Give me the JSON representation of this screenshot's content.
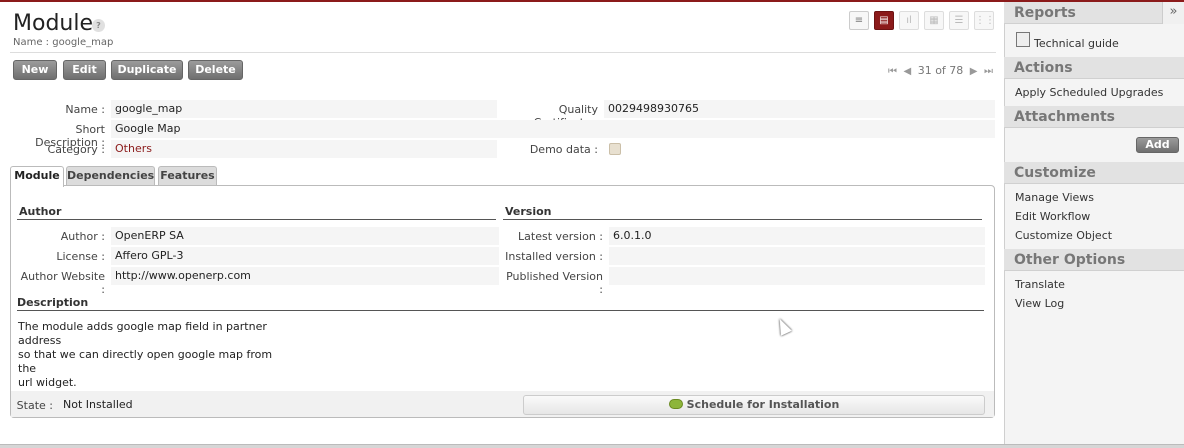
{
  "page": {
    "title": "Module",
    "help": "?",
    "subtitle": "Name : google_map"
  },
  "view_switcher": {
    "icons": [
      "list-view-icon",
      "form-view-icon",
      "graph-view-icon",
      "calendar-view-icon",
      "gantt-view-icon",
      "diagram-view-icon"
    ],
    "active": "form-view-icon"
  },
  "toolbar": {
    "new": "New",
    "edit": "Edit",
    "duplicate": "Duplicate",
    "delete": "Delete"
  },
  "pager": {
    "first": "⏮",
    "prev": "◀",
    "text": "31 of 78",
    "next": "▶",
    "last": "⏭"
  },
  "form": {
    "name_label": "Name :",
    "name_value": "google_map",
    "quality_label": "Quality Certificate :",
    "quality_value": "0029498930765",
    "short_desc_label": "Short Description :",
    "short_desc_value": "Google Map",
    "category_label": "Category :",
    "category_value": "Others",
    "demo_label": "Demo data :",
    "demo_value": false
  },
  "tabs": {
    "module": "Module",
    "dependencies": "Dependencies",
    "features": "Features"
  },
  "author_section": {
    "title": "Author",
    "author_label": "Author :",
    "author_value": "OpenERP SA",
    "license_label": "License :",
    "license_value": "Affero GPL-3",
    "website_label": "Author Website :",
    "website_value": "http://www.openerp.com"
  },
  "version_section": {
    "title": "Version",
    "latest_label": "Latest version :",
    "latest_value": "6.0.1.0",
    "installed_label": "Installed version :",
    "installed_value": "",
    "published_label": "Published Version :",
    "published_value": ""
  },
  "description": {
    "title": "Description",
    "line1": "The module adds google map field in partner address",
    "line2": "so that we can directly open google map from the",
    "line3": "url widget."
  },
  "state": {
    "label": "State :",
    "value": "Not Installed",
    "schedule_button": "Schedule for Installation"
  },
  "sidebar": {
    "collapse": "»",
    "reports": {
      "title": "Reports",
      "items": [
        "Technical guide"
      ]
    },
    "actions": {
      "title": "Actions",
      "items": [
        "Apply Scheduled Upgrades"
      ]
    },
    "attachments": {
      "title": "Attachments",
      "add": "Add"
    },
    "customize": {
      "title": "Customize",
      "items": [
        "Manage Views",
        "Edit Workflow",
        "Customize Object"
      ]
    },
    "other": {
      "title": "Other Options",
      "items": [
        "Translate",
        "View Log"
      ]
    }
  }
}
